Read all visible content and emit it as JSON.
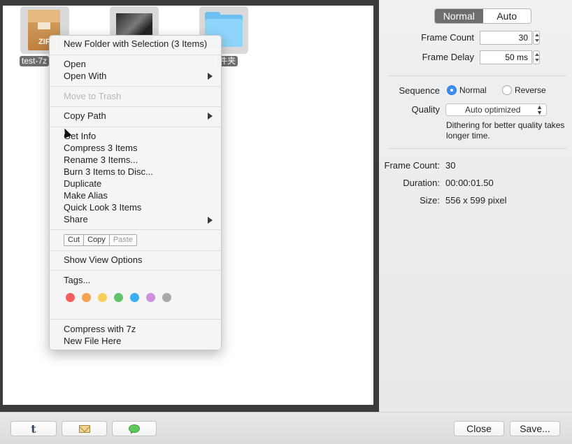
{
  "desktop": {
    "files": [
      {
        "label": "test-7z",
        "kind": "zip-archive",
        "icon_text": "ZIP"
      },
      {
        "label": "",
        "kind": "image"
      },
      {
        "label": "件夹",
        "kind": "folder"
      }
    ]
  },
  "context_menu": {
    "items": {
      "new_folder": "New Folder with Selection (3 Items)",
      "open": "Open",
      "open_with": "Open With",
      "move_to_trash": "Move to Trash",
      "copy_path": "Copy Path",
      "get_info": "Get Info",
      "compress": "Compress 3 Items",
      "rename": "Rename 3 Items...",
      "burn": "Burn 3 Items to Disc...",
      "duplicate": "Duplicate",
      "make_alias": "Make Alias",
      "quick_look": "Quick Look 3 Items",
      "share": "Share",
      "show_view_options": "Show View Options",
      "tags": "Tags...",
      "compress_7z": "Compress with 7z",
      "new_file_here": "New File Here"
    },
    "edit_buttons": {
      "cut": "Cut",
      "copy": "Copy",
      "paste": "Paste"
    },
    "tag_colors": [
      "#f25f5f",
      "#f5a34f",
      "#f7cf5a",
      "#62c36a",
      "#39aef0",
      "#cf8fe0",
      "#a9a9a9"
    ]
  },
  "settings": {
    "mode_segment": {
      "normal": "Normal",
      "auto": "Auto",
      "selected": "Normal"
    },
    "frame_count": {
      "label": "Frame Count",
      "value": "30"
    },
    "frame_delay": {
      "label": "Frame Delay",
      "value": "50 ms"
    },
    "sequence": {
      "label": "Sequence",
      "normal": "Normal",
      "reverse": "Reverse",
      "selected": "Normal"
    },
    "quality": {
      "label": "Quality",
      "value": "Auto optimized",
      "hint": "Dithering for better quality takes longer time."
    },
    "info": {
      "frame_count_label": "Frame Count:",
      "frame_count_value": "30",
      "duration_label": "Duration:",
      "duration_value": "00:00:01.50",
      "size_label": "Size:",
      "size_value": "556 x 599 pixel"
    }
  },
  "toolbar": {
    "share_buttons": [
      "tumblr-icon",
      "mail-icon",
      "messages-icon"
    ],
    "close_label": "Close",
    "save_label": "Save..."
  },
  "colors": {
    "accent": "#3d8ef4",
    "segment_selected": "#6e6e6e",
    "preview_border": "#3b3b3b"
  }
}
